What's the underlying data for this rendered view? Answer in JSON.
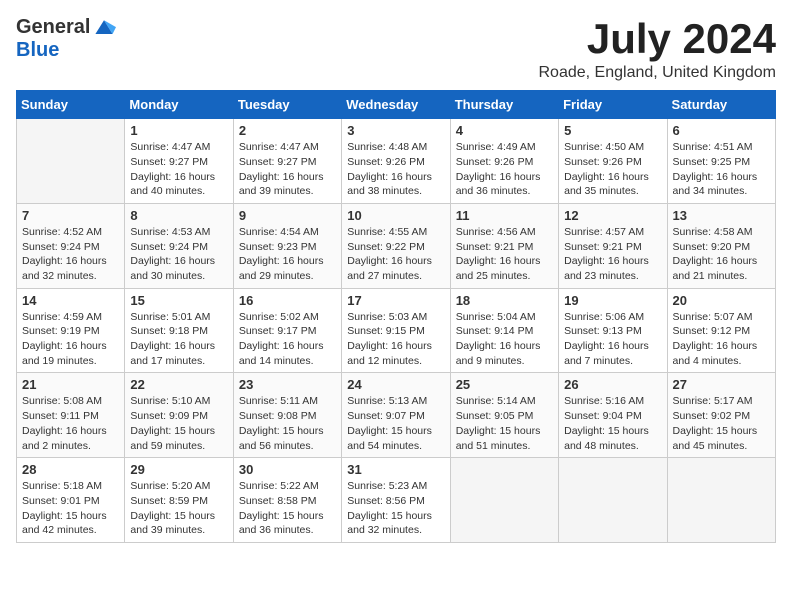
{
  "header": {
    "logo_general": "General",
    "logo_blue": "Blue",
    "month_year": "July 2024",
    "location": "Roade, England, United Kingdom"
  },
  "calendar": {
    "days_of_week": [
      "Sunday",
      "Monday",
      "Tuesday",
      "Wednesday",
      "Thursday",
      "Friday",
      "Saturday"
    ],
    "weeks": [
      [
        {
          "day": "",
          "empty": true
        },
        {
          "day": "1",
          "sunrise": "Sunrise: 4:47 AM",
          "sunset": "Sunset: 9:27 PM",
          "daylight": "Daylight: 16 hours and 40 minutes."
        },
        {
          "day": "2",
          "sunrise": "Sunrise: 4:47 AM",
          "sunset": "Sunset: 9:27 PM",
          "daylight": "Daylight: 16 hours and 39 minutes."
        },
        {
          "day": "3",
          "sunrise": "Sunrise: 4:48 AM",
          "sunset": "Sunset: 9:26 PM",
          "daylight": "Daylight: 16 hours and 38 minutes."
        },
        {
          "day": "4",
          "sunrise": "Sunrise: 4:49 AM",
          "sunset": "Sunset: 9:26 PM",
          "daylight": "Daylight: 16 hours and 36 minutes."
        },
        {
          "day": "5",
          "sunrise": "Sunrise: 4:50 AM",
          "sunset": "Sunset: 9:26 PM",
          "daylight": "Daylight: 16 hours and 35 minutes."
        },
        {
          "day": "6",
          "sunrise": "Sunrise: 4:51 AM",
          "sunset": "Sunset: 9:25 PM",
          "daylight": "Daylight: 16 hours and 34 minutes."
        }
      ],
      [
        {
          "day": "7",
          "sunrise": "Sunrise: 4:52 AM",
          "sunset": "Sunset: 9:24 PM",
          "daylight": "Daylight: 16 hours and 32 minutes."
        },
        {
          "day": "8",
          "sunrise": "Sunrise: 4:53 AM",
          "sunset": "Sunset: 9:24 PM",
          "daylight": "Daylight: 16 hours and 30 minutes."
        },
        {
          "day": "9",
          "sunrise": "Sunrise: 4:54 AM",
          "sunset": "Sunset: 9:23 PM",
          "daylight": "Daylight: 16 hours and 29 minutes."
        },
        {
          "day": "10",
          "sunrise": "Sunrise: 4:55 AM",
          "sunset": "Sunset: 9:22 PM",
          "daylight": "Daylight: 16 hours and 27 minutes."
        },
        {
          "day": "11",
          "sunrise": "Sunrise: 4:56 AM",
          "sunset": "Sunset: 9:21 PM",
          "daylight": "Daylight: 16 hours and 25 minutes."
        },
        {
          "day": "12",
          "sunrise": "Sunrise: 4:57 AM",
          "sunset": "Sunset: 9:21 PM",
          "daylight": "Daylight: 16 hours and 23 minutes."
        },
        {
          "day": "13",
          "sunrise": "Sunrise: 4:58 AM",
          "sunset": "Sunset: 9:20 PM",
          "daylight": "Daylight: 16 hours and 21 minutes."
        }
      ],
      [
        {
          "day": "14",
          "sunrise": "Sunrise: 4:59 AM",
          "sunset": "Sunset: 9:19 PM",
          "daylight": "Daylight: 16 hours and 19 minutes."
        },
        {
          "day": "15",
          "sunrise": "Sunrise: 5:01 AM",
          "sunset": "Sunset: 9:18 PM",
          "daylight": "Daylight: 16 hours and 17 minutes."
        },
        {
          "day": "16",
          "sunrise": "Sunrise: 5:02 AM",
          "sunset": "Sunset: 9:17 PM",
          "daylight": "Daylight: 16 hours and 14 minutes."
        },
        {
          "day": "17",
          "sunrise": "Sunrise: 5:03 AM",
          "sunset": "Sunset: 9:15 PM",
          "daylight": "Daylight: 16 hours and 12 minutes."
        },
        {
          "day": "18",
          "sunrise": "Sunrise: 5:04 AM",
          "sunset": "Sunset: 9:14 PM",
          "daylight": "Daylight: 16 hours and 9 minutes."
        },
        {
          "day": "19",
          "sunrise": "Sunrise: 5:06 AM",
          "sunset": "Sunset: 9:13 PM",
          "daylight": "Daylight: 16 hours and 7 minutes."
        },
        {
          "day": "20",
          "sunrise": "Sunrise: 5:07 AM",
          "sunset": "Sunset: 9:12 PM",
          "daylight": "Daylight: 16 hours and 4 minutes."
        }
      ],
      [
        {
          "day": "21",
          "sunrise": "Sunrise: 5:08 AM",
          "sunset": "Sunset: 9:11 PM",
          "daylight": "Daylight: 16 hours and 2 minutes."
        },
        {
          "day": "22",
          "sunrise": "Sunrise: 5:10 AM",
          "sunset": "Sunset: 9:09 PM",
          "daylight": "Daylight: 15 hours and 59 minutes."
        },
        {
          "day": "23",
          "sunrise": "Sunrise: 5:11 AM",
          "sunset": "Sunset: 9:08 PM",
          "daylight": "Daylight: 15 hours and 56 minutes."
        },
        {
          "day": "24",
          "sunrise": "Sunrise: 5:13 AM",
          "sunset": "Sunset: 9:07 PM",
          "daylight": "Daylight: 15 hours and 54 minutes."
        },
        {
          "day": "25",
          "sunrise": "Sunrise: 5:14 AM",
          "sunset": "Sunset: 9:05 PM",
          "daylight": "Daylight: 15 hours and 51 minutes."
        },
        {
          "day": "26",
          "sunrise": "Sunrise: 5:16 AM",
          "sunset": "Sunset: 9:04 PM",
          "daylight": "Daylight: 15 hours and 48 minutes."
        },
        {
          "day": "27",
          "sunrise": "Sunrise: 5:17 AM",
          "sunset": "Sunset: 9:02 PM",
          "daylight": "Daylight: 15 hours and 45 minutes."
        }
      ],
      [
        {
          "day": "28",
          "sunrise": "Sunrise: 5:18 AM",
          "sunset": "Sunset: 9:01 PM",
          "daylight": "Daylight: 15 hours and 42 minutes."
        },
        {
          "day": "29",
          "sunrise": "Sunrise: 5:20 AM",
          "sunset": "Sunset: 8:59 PM",
          "daylight": "Daylight: 15 hours and 39 minutes."
        },
        {
          "day": "30",
          "sunrise": "Sunrise: 5:22 AM",
          "sunset": "Sunset: 8:58 PM",
          "daylight": "Daylight: 15 hours and 36 minutes."
        },
        {
          "day": "31",
          "sunrise": "Sunrise: 5:23 AM",
          "sunset": "Sunset: 8:56 PM",
          "daylight": "Daylight: 15 hours and 32 minutes."
        },
        {
          "day": "",
          "empty": true
        },
        {
          "day": "",
          "empty": true
        },
        {
          "day": "",
          "empty": true
        }
      ]
    ]
  }
}
